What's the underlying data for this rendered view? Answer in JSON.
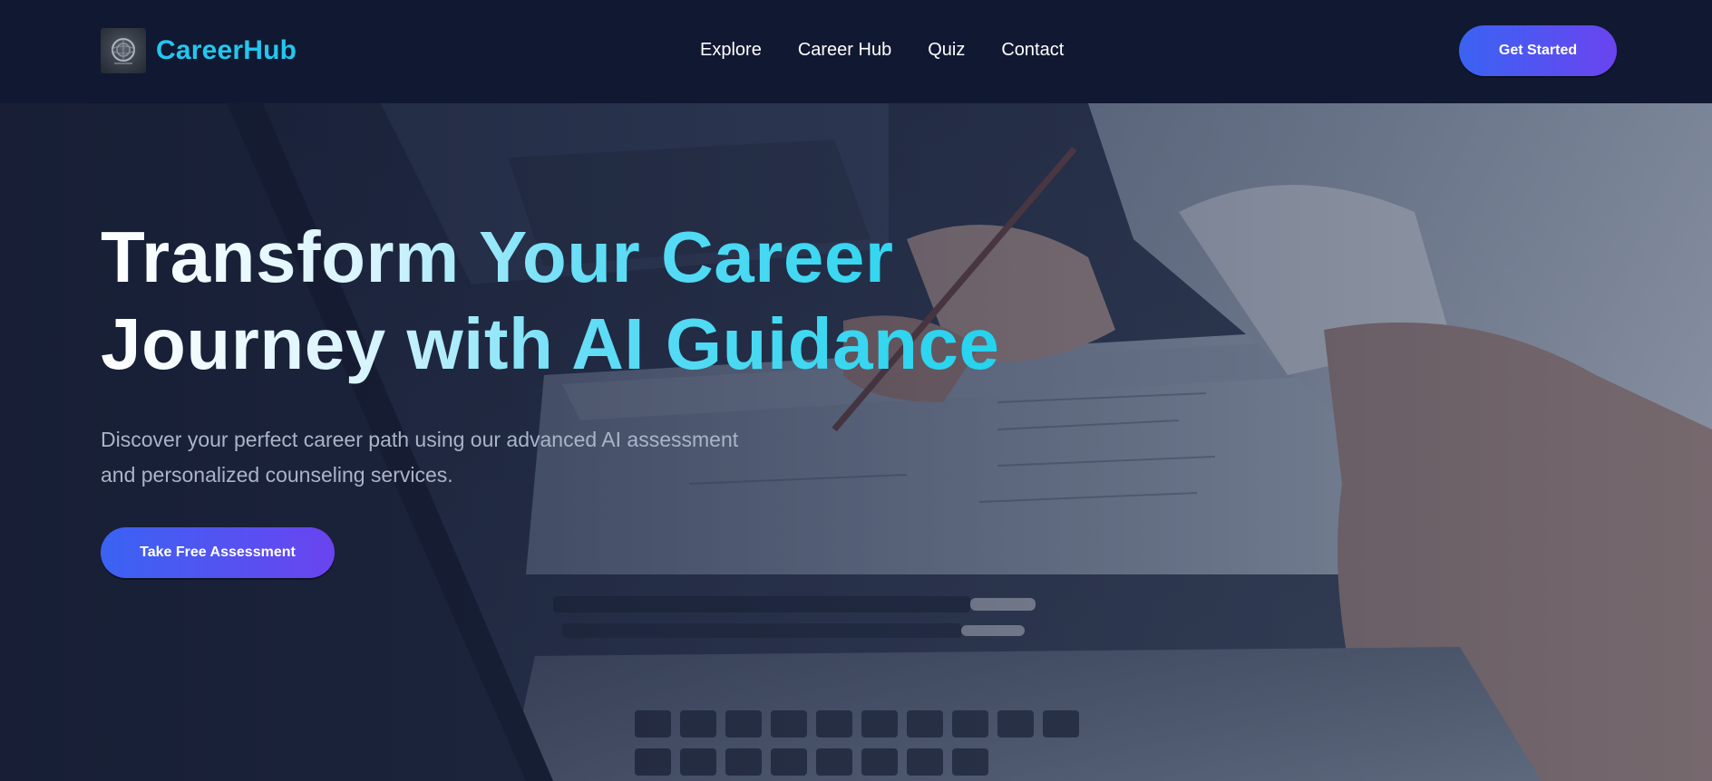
{
  "brand": {
    "name": "CareerHub",
    "logo_icon": "globe-emblem-icon",
    "color": "#22c7ee"
  },
  "nav": {
    "links": [
      {
        "label": "Explore"
      },
      {
        "label": "Career Hub"
      },
      {
        "label": "Quiz"
      },
      {
        "label": "Contact"
      }
    ],
    "cta_label": "Get Started"
  },
  "hero": {
    "title_lines": [
      "Transform Your Career",
      "Journey with AI Guidance"
    ],
    "subtitle_lines": [
      "Discover your perfect career path using our advanced AI assessment",
      "and personalized counseling services."
    ],
    "cta_label": "Take Free Assessment",
    "background_image": "office-desk-laptop-documents-photo"
  },
  "colors": {
    "navbar_bg": "#111832",
    "accent_cyan": "#22d3ee",
    "button_gradient_start": "#3a63f2",
    "button_gradient_end": "#6a44ef",
    "subtitle_text": "#aab4c6"
  }
}
